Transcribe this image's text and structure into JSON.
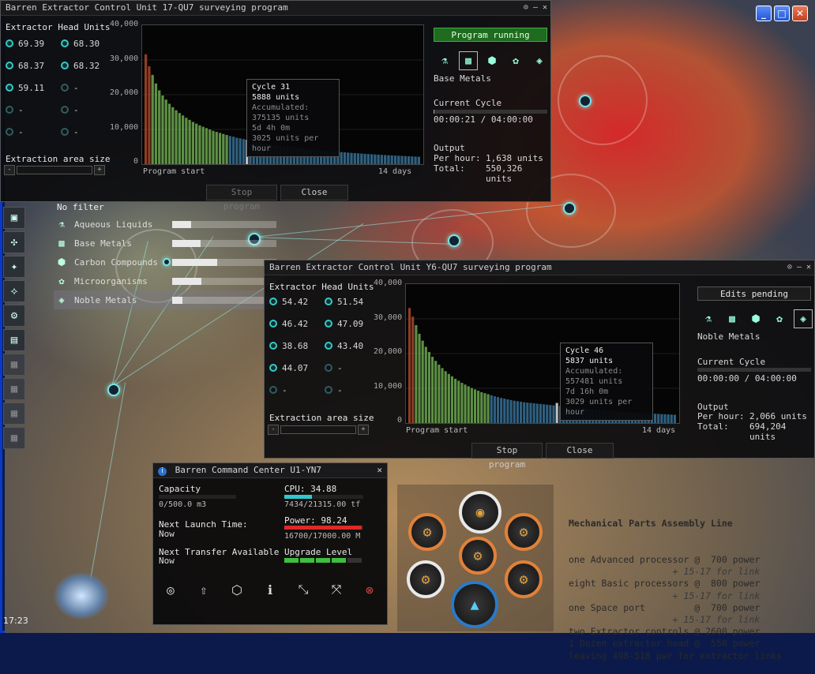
{
  "top_window": {
    "title": "Barren Extractor Control Unit 17-QU7 surveying program",
    "heads_title": "Extractor Head Units",
    "heads": [
      "69.39",
      "68.30",
      "68.37",
      "68.32",
      "59.11",
      "-",
      "-",
      "-",
      "-",
      "-"
    ],
    "area_label": "Extraction area size",
    "status": "Program running",
    "resource": "Base Metals",
    "cycle_label": "Current Cycle",
    "cycle_time": "00:00:21 / 04:00:00",
    "cycle_progress": 0.0015,
    "output_label": "Output",
    "per_hour_label": "Per hour:",
    "per_hour": "1,638 units",
    "total_label": "Total:",
    "total": "550,326",
    "total_unit": "units",
    "stop_button": "Stop program",
    "close_button": "Close",
    "tooltip": {
      "cycle": "Cycle 31",
      "units": "5888 units",
      "acc_label": "Accumulated:",
      "acc": "375135 units",
      "time": "5d 4h 0m",
      "rate": "3025 units per hour"
    }
  },
  "mid_window": {
    "title": "Barren Extractor Control Unit Y6-QU7 surveying program",
    "heads_title": "Extractor Head Units",
    "heads": [
      "54.42",
      "51.54",
      "46.42",
      "47.09",
      "38.68",
      "43.40",
      "44.07",
      "-",
      "-",
      "-"
    ],
    "area_label": "Extraction area size",
    "status": "Edits pending",
    "resource": "Noble Metals",
    "cycle_label": "Current Cycle",
    "cycle_time": "00:00:00 / 04:00:00",
    "cycle_progress": 0,
    "output_label": "Output",
    "per_hour_label": "Per hour:",
    "per_hour": "2,066 units",
    "total_label": "Total:",
    "total": "694,204",
    "total_unit": "units",
    "stop_button": "Stop program",
    "close_button": "Close",
    "tooltip": {
      "cycle": "Cycle 46",
      "units": "5837 units",
      "acc_label": "Accumulated:",
      "acc": "557481 units",
      "time": "7d 16h 0m",
      "rate": "3029 units per hour"
    }
  },
  "chart_data": [
    {
      "type": "bar",
      "xlabel_start": "Program start",
      "xlabel_end": "14 days",
      "yticks": [
        "40,000",
        "30,000",
        "20,000",
        "10,000",
        "0"
      ],
      "ylim": [
        0,
        40000
      ],
      "highlight_cycle": 31,
      "values": [
        32000,
        28500,
        26000,
        23500,
        21500,
        20000,
        18800,
        17600,
        16600,
        15700,
        14900,
        14200,
        13500,
        12900,
        12300,
        11800,
        11300,
        10900,
        10500,
        10100,
        9700,
        9400,
        9100,
        8800,
        8500,
        8200,
        8000,
        7700,
        7500,
        7300,
        7100,
        5888,
        6700,
        6500,
        6300,
        6150,
        6000,
        5850,
        5700,
        5550,
        5400,
        5250,
        5100,
        4950,
        4850,
        4750,
        4650,
        4550,
        4450,
        4350,
        4250,
        4150,
        4050,
        3950,
        3850,
        3760,
        3680,
        3600,
        3520,
        3440,
        3360,
        3290,
        3220,
        3150,
        3080,
        3010,
        2950,
        2890,
        2830,
        2770,
        2710,
        2650,
        2600,
        2550,
        2500,
        2450,
        2400,
        2350,
        2300,
        2250,
        2200,
        2160
      ]
    },
    {
      "type": "bar",
      "xlabel_start": "Program start",
      "xlabel_end": "14 days",
      "yticks": [
        "40,000",
        "30,000",
        "20,000",
        "10,000",
        "0"
      ],
      "ylim": [
        0,
        40000
      ],
      "highlight_cycle": 46,
      "values": [
        33500,
        31000,
        28500,
        26000,
        24000,
        22200,
        20700,
        19300,
        18100,
        17000,
        16000,
        15100,
        14300,
        13600,
        12900,
        12300,
        11700,
        11200,
        10700,
        10200,
        9800,
        9400,
        9000,
        8700,
        8400,
        8100,
        7800,
        7550,
        7300,
        7100,
        6900,
        6700,
        6500,
        6350,
        6200,
        6050,
        5950,
        5850,
        5750,
        5650,
        5550,
        5450,
        5350,
        5250,
        5150,
        5837,
        4950,
        4850,
        4750,
        4650,
        4550,
        4450,
        4350,
        4260,
        4170,
        4080,
        3990,
        3900,
        3820,
        3740,
        3660,
        3580,
        3500,
        3430,
        3360,
        3290,
        3220,
        3150,
        3090,
        3030,
        2970,
        2910,
        2850,
        2800,
        2750,
        2700,
        2650,
        2600,
        2550,
        2500,
        2450,
        2400
      ]
    }
  ],
  "filter": {
    "title": "No filter",
    "items": [
      {
        "label": "Aqueous Liquids",
        "value": 0.18
      },
      {
        "label": "Base Metals",
        "value": 0.27
      },
      {
        "label": "Carbon Compounds",
        "value": 0.43
      },
      {
        "label": "Microorganisms",
        "value": 0.28
      },
      {
        "label": "Noble Metals",
        "value": 0.1
      }
    ]
  },
  "command_center": {
    "title": "Barren Command Center U1-YN7",
    "capacity_label": "Capacity",
    "capacity": "0/500.0 m3",
    "capacity_fill": 0,
    "cpu_label": "CPU: 34.88",
    "cpu_value": "7434/21315.00 tf",
    "cpu_fill": 0.35,
    "power_label": "Power: 98.24",
    "power_value": "16700/17000.00 M",
    "power_fill": 0.98,
    "launch_label": "Next Launch Time:",
    "launch_value": "Now",
    "transfer_label": "Next Transfer Available",
    "transfer_value": "Now",
    "upgrade_label": "Upgrade Level",
    "upgrade_level": 4,
    "upgrade_max": 5
  },
  "note": {
    "title": "Mechanical Parts Assembly Line",
    "lines": [
      "one Advanced processor @  700 power",
      "                   + 15-17 for link",
      "eight Basic processors @  800 power",
      "                   + 15-17 for link",
      "one Space port         @  700 power",
      "                   + 15-17 for link",
      "two Extractor controls @ 2600 power",
      "1 Dozen extractor head @  550 power",
      "leaving 498-518 pwr for extractor links"
    ]
  },
  "clock": "17:23",
  "xp_buttons": {
    "min": "_",
    "max": "□",
    "close": "✕"
  },
  "colors": {
    "bar_green": "#7bbf5a",
    "bar_blue": "#3d7faa",
    "bar_red": "#c05030",
    "accent": "#38c9c4",
    "running": "#1f6b1f"
  }
}
